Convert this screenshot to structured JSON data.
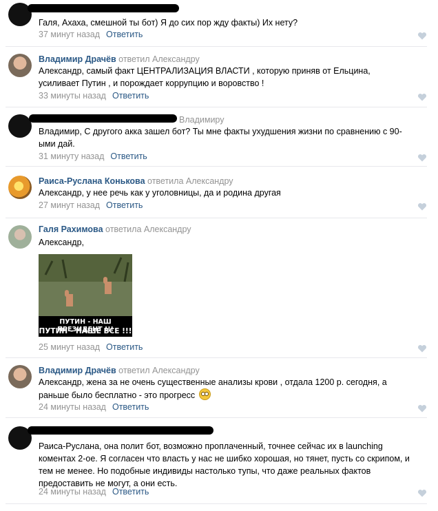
{
  "icons": {
    "like": "heart-icon"
  },
  "colors": {
    "link": "#2a5885",
    "muted": "#939393",
    "divider": "#e7e8ec"
  },
  "comments": [
    {
      "author": "",
      "reply_prefix": "",
      "text": "Галя, Ахаха, смешной ты бот) Я до сих пор жду факты) Их нету?",
      "time": "37 минут назад",
      "reply": "Ответить"
    },
    {
      "author": "Владимир Драчёв",
      "reply_prefix": "ответил Александру",
      "text": "Александр, самый факт ЦЕНТРАЛИЗАЦИЯ ВЛАСТИ , которую приняв от Ельцина, усиливает Путин , и порождает коррупцию и воровство !",
      "time": "33 минуты назад",
      "reply": "Ответить"
    },
    {
      "author": "",
      "reply_prefix": "Владимиру",
      "text": "Владимир, С другого акка зашел бот? Ты мне факты ухудшения жизни по сравнению с 90-ыми дай.",
      "time": "31 минуту назад",
      "reply": "Ответить"
    },
    {
      "author": "Раиса-Руслана Конькова",
      "reply_prefix": "ответила Александру",
      "text": "Александр, у нее речь как у уголовницы, да и родина другая",
      "time": "27 минут назад",
      "reply": "Ответить"
    },
    {
      "author": "Галя Рахимова",
      "reply_prefix": "ответила Александру",
      "text": "Александр,",
      "meme_line1": "ПУТИН - НАШ ПРЕЗИДЕНТ !!!",
      "meme_line2": "ПУТИН - НАШЕ ВСЕ !!!",
      "time": "25 минут назад",
      "reply": "Ответить"
    },
    {
      "author": "Владимир Драчёв",
      "reply_prefix": "ответил Александру",
      "text": "Александр, жена за не очень существенные анализы крови , отдала 1200 р. сегодня, а раньше было бесплатно - это прогресс",
      "time": "24 минуты назад",
      "reply": "Ответить"
    },
    {
      "author": "",
      "reply_prefix": "",
      "text": "Раиса-Руслана, она полит бот, возможно проплаченный, точнее сейчас их в launching коментах 2-ое. Я согласен что власть у нас не шибко хорошая, но тянет, пусть со скрипом, и тем не менее. Но подобные индивиды настолько тупы, что даже реальных фактов предоставить не могут, а они есть.",
      "time": "24 минуты назад",
      "reply": "Ответить"
    }
  ]
}
